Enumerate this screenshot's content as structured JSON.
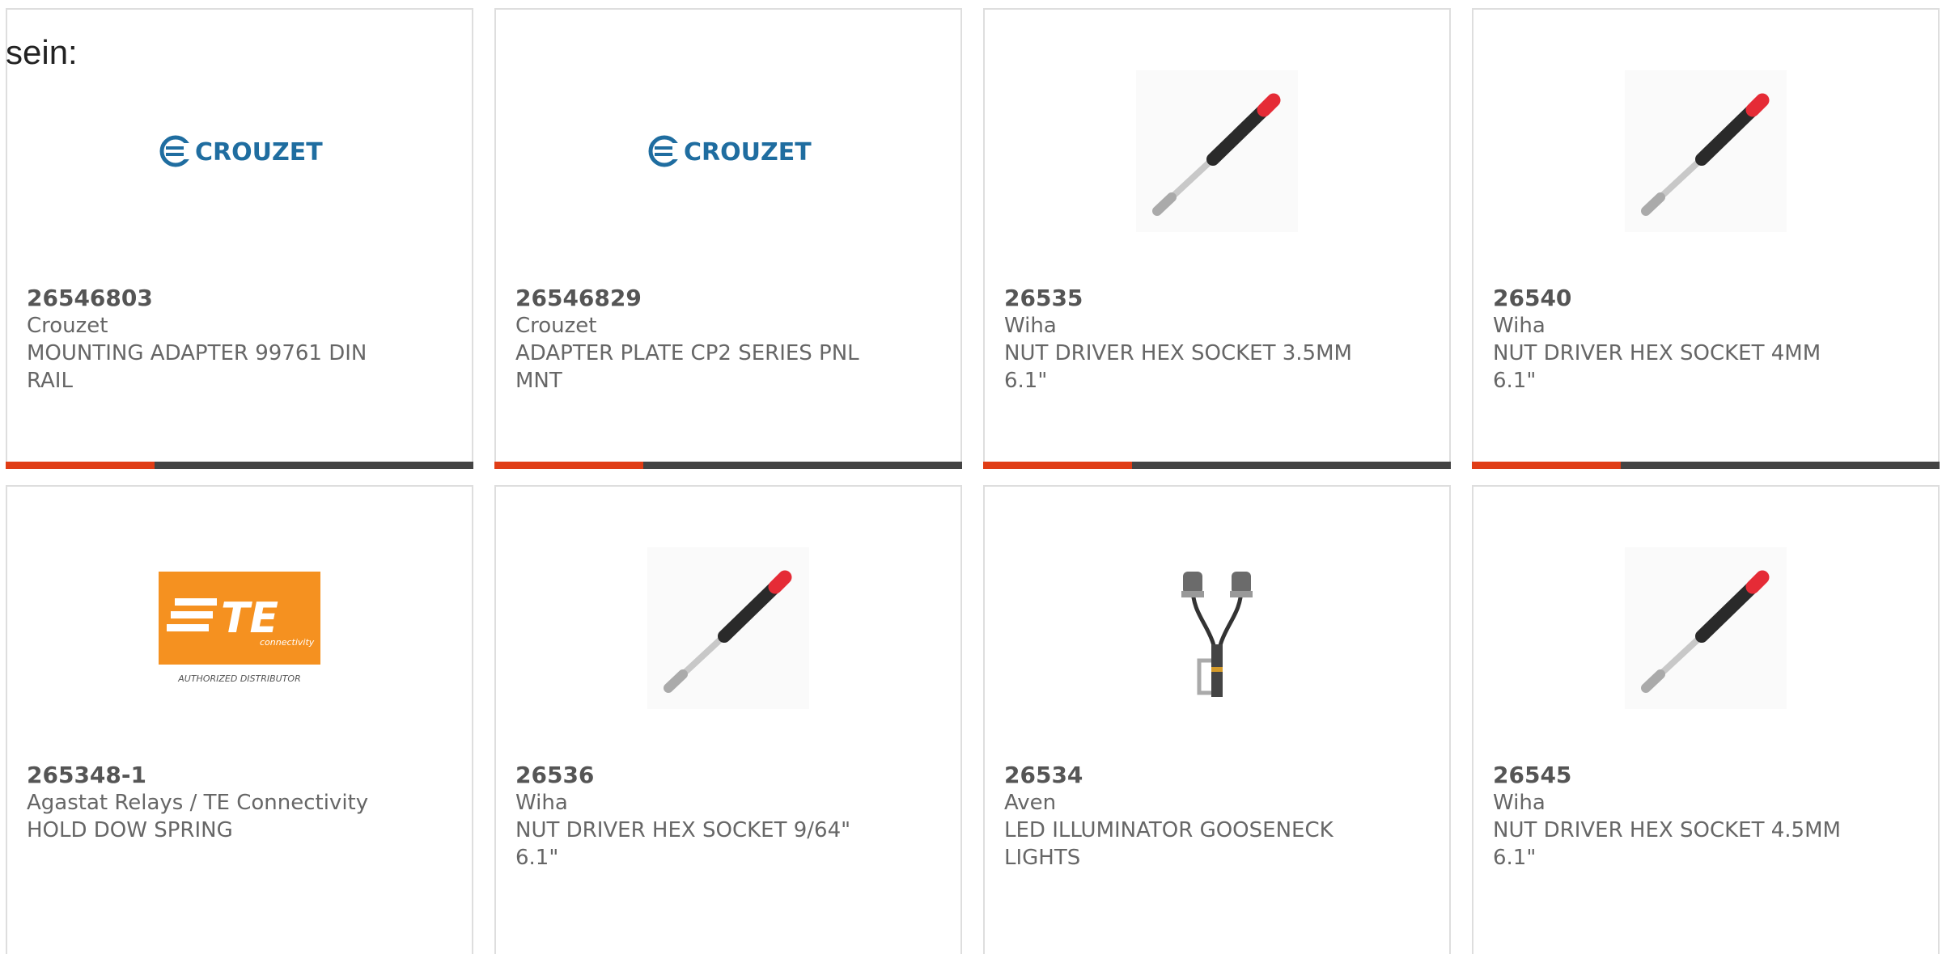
{
  "header": {
    "label": "sein:"
  },
  "colors": {
    "accent": "#e03d16",
    "bar_dark": "#444444",
    "crouzet_blue": "#1f6da0",
    "te_orange": "#f59120"
  },
  "products": [
    {
      "part_number": "26546803",
      "manufacturer": "Crouzet",
      "description": "MOUNTING ADAPTER 99761 DIN RAIL",
      "image": "crouzet-logo",
      "logo_text": "CROUZET"
    },
    {
      "part_number": "26546829",
      "manufacturer": "Crouzet",
      "description": "ADAPTER PLATE CP2 SERIES PNL MNT",
      "image": "crouzet-logo",
      "logo_text": "CROUZET"
    },
    {
      "part_number": "26535",
      "manufacturer": "Wiha",
      "description": "NUT DRIVER HEX SOCKET 3.5MM 6.1\"",
      "image": "nut-driver-photo"
    },
    {
      "part_number": "26540",
      "manufacturer": "Wiha",
      "description": "NUT DRIVER HEX SOCKET 4MM 6.1\"",
      "image": "nut-driver-photo"
    },
    {
      "part_number": "265348-1",
      "manufacturer": "Agastat Relays / TE Connectivity",
      "description": "HOLD DOW SPRING",
      "image": "te-connectivity-logo",
      "logo_text": "TE",
      "logo_subtext": "connectivity",
      "logo_caption": "AUTHORIZED DISTRIBUTOR"
    },
    {
      "part_number": "26536",
      "manufacturer": "Wiha",
      "description": "NUT DRIVER HEX SOCKET 9/64\" 6.1\"",
      "image": "nut-driver-photo"
    },
    {
      "part_number": "26534",
      "manufacturer": "Aven",
      "description": "LED ILLUMINATOR GOOSENECK LIGHTS",
      "image": "gooseneck-light-photo"
    },
    {
      "part_number": "26545",
      "manufacturer": "Wiha",
      "description": "NUT DRIVER HEX SOCKET 4.5MM 6.1\"",
      "image": "nut-driver-photo"
    }
  ]
}
